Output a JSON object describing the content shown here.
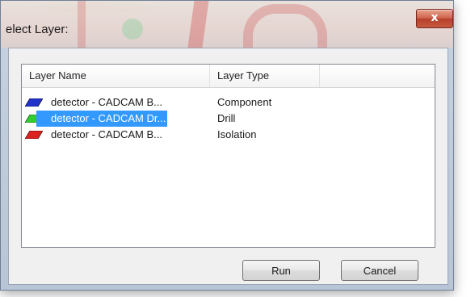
{
  "window": {
    "title": "elect Layer:",
    "close_glyph": "x"
  },
  "list": {
    "columns": [
      "Layer Name",
      "Layer Type"
    ],
    "rows": [
      {
        "name": "detector - CADCAM B...",
        "type": "Component",
        "color": "#2233cc",
        "selected": false
      },
      {
        "name": "detector - CADCAM Dr...",
        "type": "Drill",
        "color": "#33cc33",
        "selected": true
      },
      {
        "name": "detector - CADCAM B...",
        "type": "Isolation",
        "color": "#dd2222",
        "selected": false
      }
    ]
  },
  "buttons": {
    "run": "Run",
    "cancel": "Cancel"
  },
  "colors": {
    "selection": "#3399ff",
    "close_button": "#c55b3f"
  }
}
